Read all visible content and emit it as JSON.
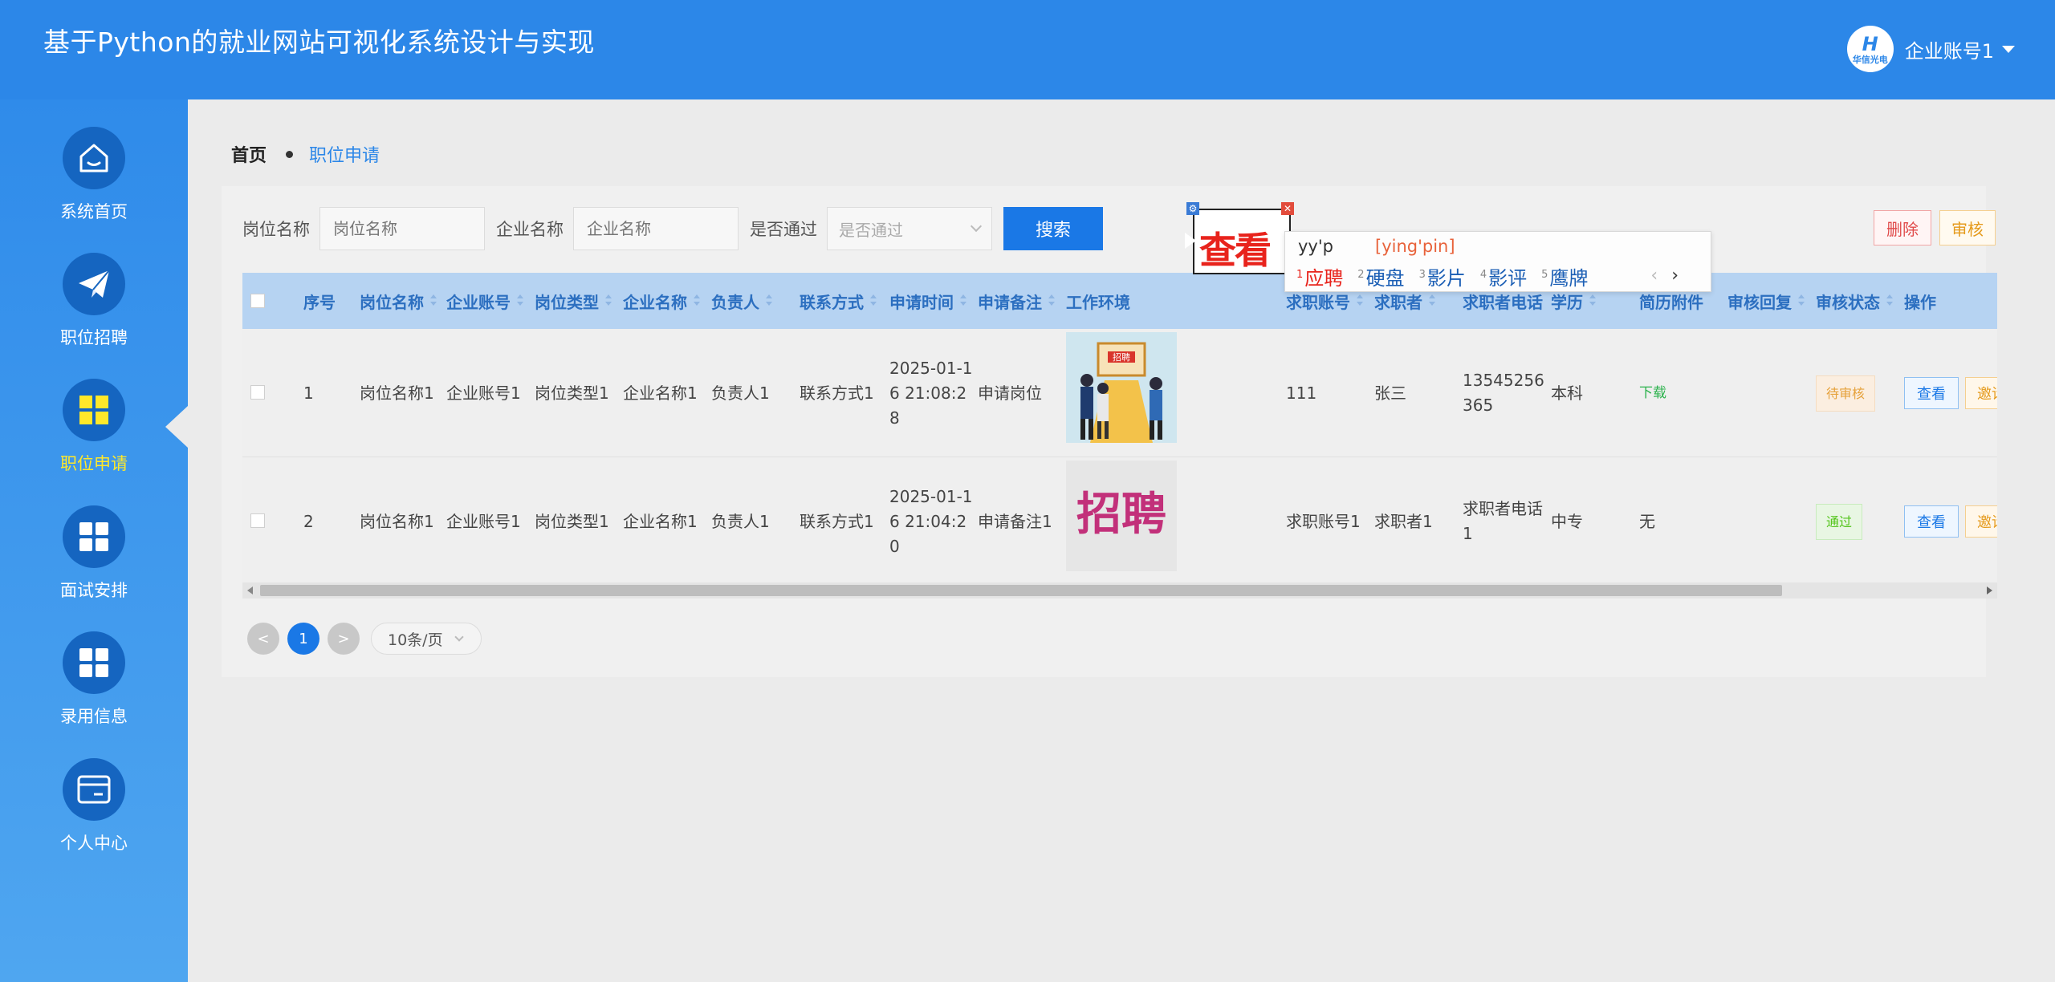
{
  "header": {
    "title": "基于Python的就业网站可视化系统设计与实现",
    "avatar_text": "华信光电",
    "avatar_glyph": "H",
    "account": "企业账号1"
  },
  "sidebar": {
    "items": [
      {
        "label": "系统首页",
        "icon": "home-icon"
      },
      {
        "label": "职位招聘",
        "icon": "paper-plane-icon"
      },
      {
        "label": "职位申请",
        "icon": "grid-icon",
        "active": true
      },
      {
        "label": "面试安排",
        "icon": "grid-icon"
      },
      {
        "label": "录用信息",
        "icon": "grid-icon"
      },
      {
        "label": "个人中心",
        "icon": "card-icon"
      }
    ]
  },
  "breadcrumb": {
    "home": "首页",
    "current": "职位申请"
  },
  "search": {
    "job_label": "岗位名称",
    "job_placeholder": "岗位名称",
    "company_label": "企业名称",
    "company_placeholder": "企业名称",
    "pass_label": "是否通过",
    "pass_placeholder": "是否通过",
    "search_button": "搜索"
  },
  "actions": {
    "delete": "删除",
    "audit": "审核"
  },
  "table": {
    "headers": {
      "index": "序号",
      "job_name": "岗位名称",
      "company_account": "企业账号",
      "job_type": "岗位类型",
      "company_name": "企业名称",
      "manager": "负责人",
      "contact": "联系方式",
      "apply_time": "申请时间",
      "apply_note": "申请备注",
      "work_env": "工作环境",
      "seeker_account": "求职账号",
      "seeker": "求职者",
      "seeker_phone": "求职者电话",
      "education": "学历",
      "resume": "简历附件",
      "audit_reply": "审核回复",
      "audit_status": "审核状态",
      "operation": "操作"
    },
    "rows": [
      {
        "index": "1",
        "job_name": "岗位名称1",
        "company_account": "企业账号1",
        "job_type": "岗位类型1",
        "company_name": "企业名称1",
        "manager": "负责人1",
        "contact": "联系方式1",
        "apply_time": "2025-01-16 21:08:28",
        "apply_note": "申请岗位",
        "image_text": "招聘",
        "seeker_account": "111",
        "seeker": "张三",
        "seeker_phone": "13545256365",
        "education": "本科",
        "resume": "下载",
        "audit_reply": "",
        "audit_status": "待审核",
        "view": "查看",
        "invite": "邀请"
      },
      {
        "index": "2",
        "job_name": "岗位名称1",
        "company_account": "企业账号1",
        "job_type": "岗位类型1",
        "company_name": "企业名称1",
        "manager": "负责人1",
        "contact": "联系方式1",
        "apply_time": "2025-01-16 21:04:20",
        "apply_note": "申请备注1",
        "image_text": "招聘",
        "seeker_account": "求职账号1",
        "seeker": "求职者1",
        "seeker_phone": "求职者电话1",
        "education": "中专",
        "resume": "无",
        "audit_reply": "",
        "audit_status": "通过",
        "view": "查看",
        "invite": "邀请"
      }
    ]
  },
  "pagination": {
    "prev": "<",
    "current": "1",
    "next": ">",
    "page_size": "10条/页"
  },
  "ime": {
    "composing": "查看",
    "input": "yy'p",
    "pinyin": "[ying'pin]",
    "candidates": [
      {
        "num": "1",
        "text": "应聘"
      },
      {
        "num": "2",
        "text": "硬盘"
      },
      {
        "num": "3",
        "text": "影片"
      },
      {
        "num": "4",
        "text": "影评"
      },
      {
        "num": "5",
        "text": "鹰牌"
      }
    ],
    "prev": "‹",
    "next": "›"
  },
  "colors": {
    "primary": "#2c87e8",
    "active_nav": "#ffe82a",
    "header_row": "#b6d3f2"
  }
}
